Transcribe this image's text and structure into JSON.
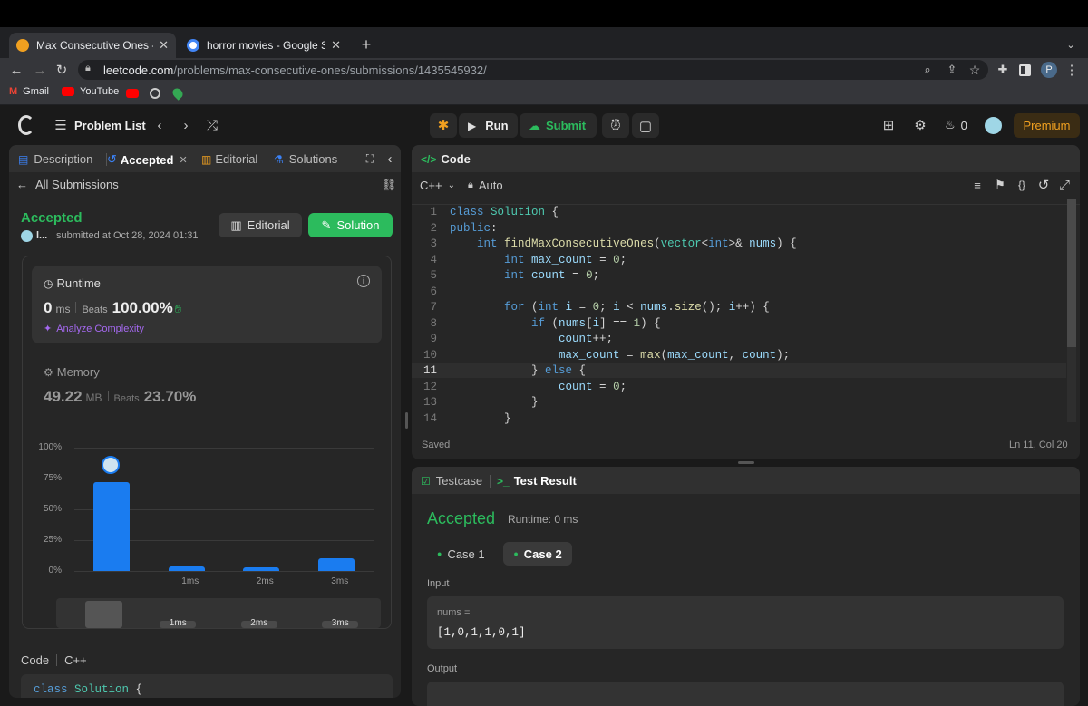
{
  "browser": {
    "tabs": [
      {
        "title": "Max Consecutive Ones - LeetC",
        "active": true
      },
      {
        "title": "horror movies - Google Search",
        "active": false
      }
    ],
    "new_tab": "+",
    "url_host": "leetcode.com",
    "url_path": "/problems/max-consecutive-ones/submissions/1435545932/",
    "profile_initial": "P",
    "bookmarks": [
      "Gmail",
      "YouTube"
    ]
  },
  "nav": {
    "problem_list": "Problem List",
    "run": "Run",
    "submit": "Submit",
    "streak": "0",
    "premium": "Premium"
  },
  "left": {
    "tabs": [
      "Description",
      "Accepted",
      "Editorial",
      "Solutions"
    ],
    "all_submissions": "All Submissions",
    "status": "Accepted",
    "user": "l...",
    "submitted": "submitted at Oct 28, 2024 01:31",
    "editorial_btn": "Editorial",
    "solution_btn": "Solution",
    "runtime": {
      "label": "Runtime",
      "value": "0",
      "unit": "ms",
      "beats_label": "Beats",
      "beats": "100.00%",
      "analyze": "Analyze Complexity"
    },
    "memory": {
      "label": "Memory",
      "value": "49.22",
      "unit": "MB",
      "beats_label": "Beats",
      "beats": "23.70%"
    },
    "code_label": "Code",
    "code_lang": "C++",
    "code_preview_class": "class",
    "code_preview_name": "Solution",
    "code_preview_brace": " {"
  },
  "chart_data": {
    "type": "bar",
    "categories": [
      "0ms",
      "1ms",
      "2ms",
      "3ms"
    ],
    "values": [
      72,
      4,
      3,
      10
    ],
    "tick_labels": [
      "",
      "1ms",
      "2ms",
      "3ms"
    ],
    "ylim": [
      0,
      100
    ],
    "yticks": [
      "100%",
      "75%",
      "50%",
      "25%",
      "0%"
    ],
    "minimap_labels": [
      "1ms",
      "2ms",
      "3ms"
    ]
  },
  "editor": {
    "title": "Code",
    "lang": "C++",
    "mode": "Auto",
    "saved": "Saved",
    "cursor": "Ln 11, Col 20",
    "active_line": 11
  },
  "result": {
    "tabs": [
      "Testcase",
      "Test Result"
    ],
    "status": "Accepted",
    "runtime": "Runtime: 0 ms",
    "cases": [
      "Case 1",
      "Case 2"
    ],
    "input_label": "Input",
    "var_name": "nums =",
    "input_value": "[1,0,1,1,0,1]",
    "output_label": "Output"
  }
}
